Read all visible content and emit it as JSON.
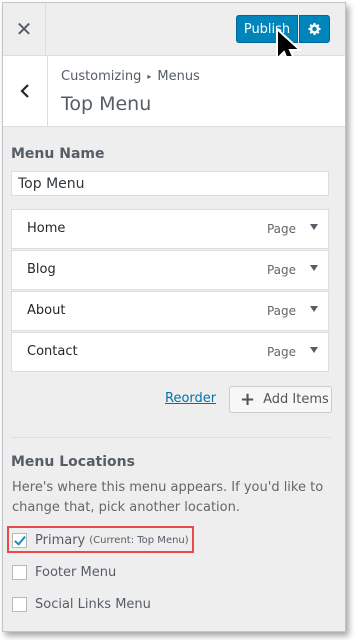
{
  "header": {
    "close_symbol": "✕",
    "publish_label": "Publish",
    "gear_icon": "gear-icon",
    "accent_color": "#0085ba"
  },
  "section": {
    "breadcrumb_parent": "Customizing",
    "breadcrumb_separator": "▸",
    "breadcrumb_current": "Menus",
    "title": "Top Menu"
  },
  "menu_name": {
    "label": "Menu Name",
    "value": "Top Menu"
  },
  "menu_items": [
    {
      "title": "Home",
      "type": "Page"
    },
    {
      "title": "Blog",
      "type": "Page"
    },
    {
      "title": "About",
      "type": "Page"
    },
    {
      "title": "Contact",
      "type": "Page"
    }
  ],
  "actions": {
    "reorder_label": "Reorder",
    "add_items_icon": "+",
    "add_items_label": "Add Items"
  },
  "locations": {
    "heading": "Menu Locations",
    "description": "Here's where this menu appears. If you'd like to change that, pick another location.",
    "options": [
      {
        "label": "Primary",
        "note": "(Current: Top Menu)",
        "checked": true
      },
      {
        "label": "Footer Menu",
        "note": "",
        "checked": false
      },
      {
        "label": "Social Links Menu",
        "note": "",
        "checked": false
      }
    ],
    "highlight_color": "#e84a4a"
  }
}
